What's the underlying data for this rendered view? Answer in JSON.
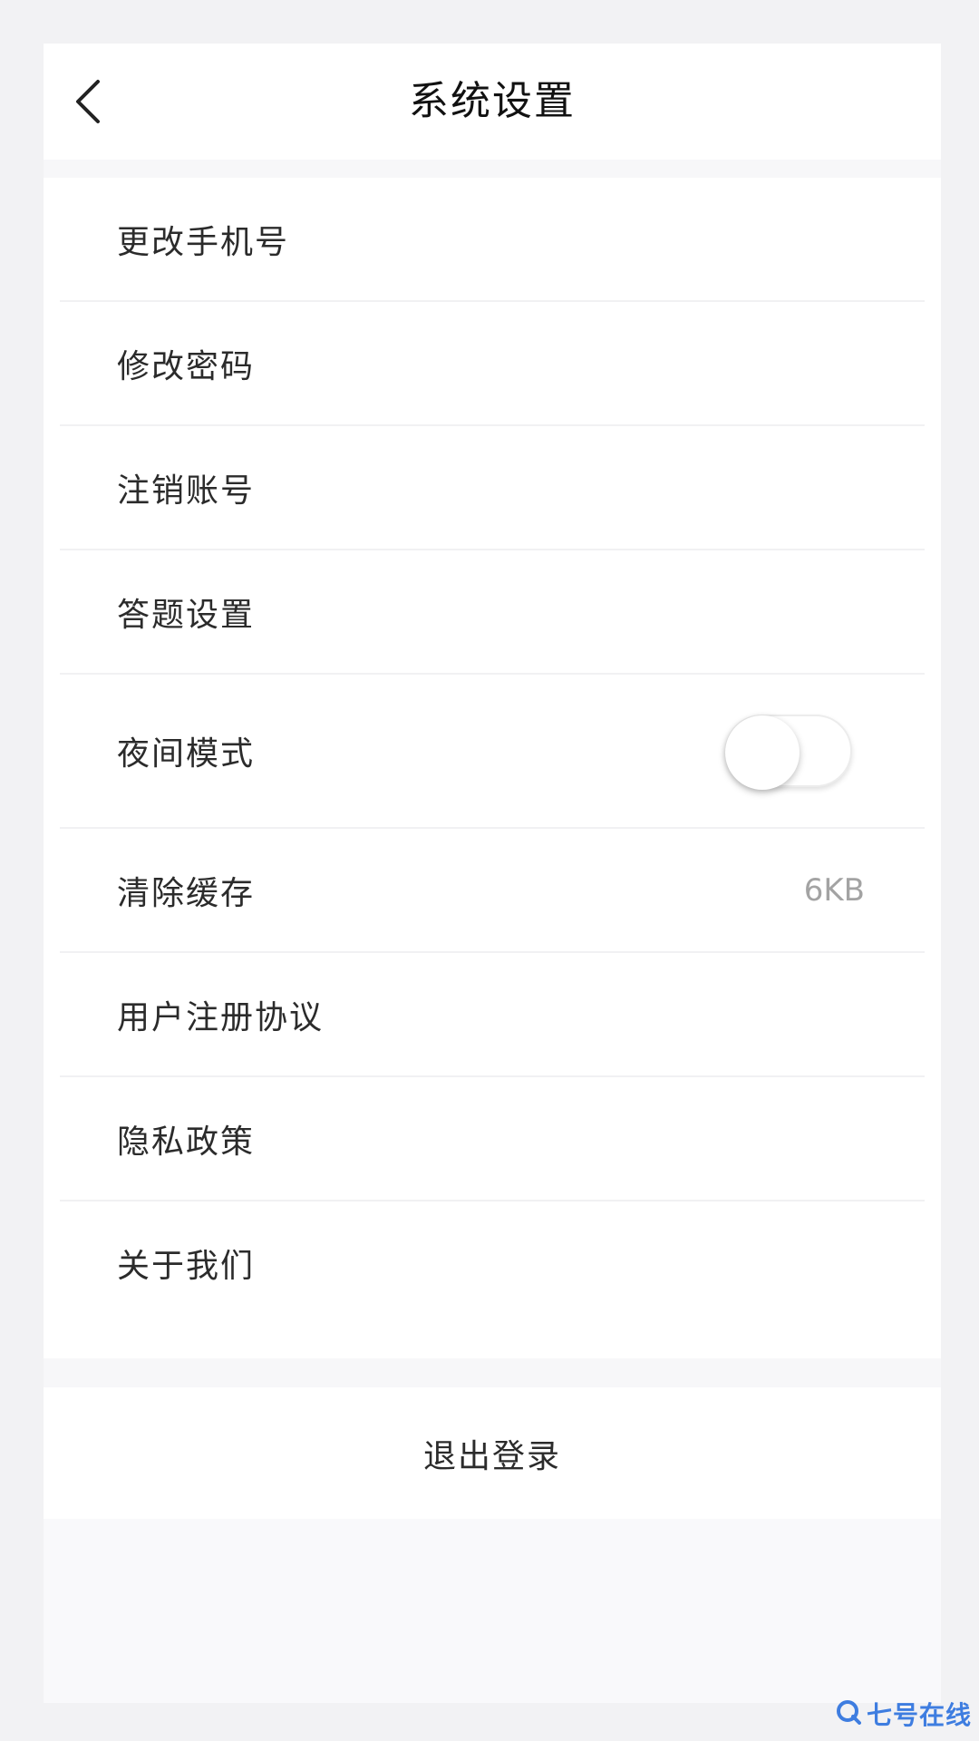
{
  "header": {
    "title": "系统设置",
    "back_icon": "chevron-left-icon"
  },
  "settings": {
    "change_phone": "更改手机号",
    "change_password": "修改密码",
    "cancel_account": "注销账号",
    "quiz_settings": "答题设置",
    "night_mode": "夜间模式",
    "night_mode_enabled": false,
    "clear_cache": "清除缓存",
    "cache_size": "6KB",
    "user_agreement": "用户注册协议",
    "privacy_policy": "隐私政策",
    "about_us": "关于我们"
  },
  "logout": {
    "label": "退出登录"
  },
  "watermark": {
    "text": "七号在线",
    "color": "#3e7de0"
  },
  "colors": {
    "page_background": "#f2f2f4",
    "card_background": "#ffffff",
    "text_primary": "#2b2b2b",
    "text_secondary": "#a3a3a3"
  }
}
